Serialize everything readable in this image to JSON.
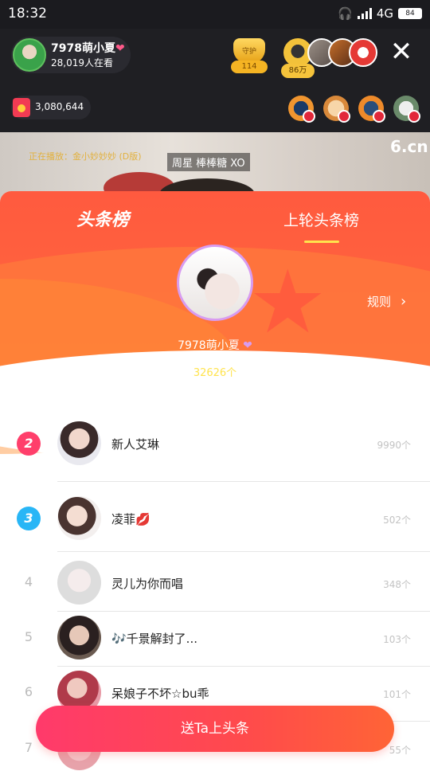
{
  "status_bar": {
    "time": "18:32",
    "network": "4G",
    "battery": "84"
  },
  "live": {
    "host_name": "7978萌小夏",
    "viewers": "28,019人在看",
    "guard_label": "守护",
    "guard_count": "114",
    "fan_badge": "86万",
    "coins": "3,080,644"
  },
  "video": {
    "scrolling_text": "正在播放：金小妙妙妙 (D版)",
    "song_label": "周星  棒棒糖  XO",
    "logo": "6.cn"
  },
  "sheet": {
    "tab_current": "头条榜",
    "tab_previous": "上轮头条榜",
    "top": {
      "name": "7978萌小夏",
      "count": "32626个"
    },
    "rules_label": "规则"
  },
  "ranking": [
    {
      "rank": "2",
      "name": "新人艾琳",
      "count": "9990个"
    },
    {
      "rank": "3",
      "name": "凌菲💋",
      "count": "502个"
    },
    {
      "rank": "4",
      "name": "灵儿为你而唱",
      "count": "348个"
    },
    {
      "rank": "5",
      "name": "🎶千景解封了...",
      "count": "103个"
    },
    {
      "rank": "6",
      "name": "呆娘子不坏☆bu乖",
      "count": "101个"
    },
    {
      "rank": "7",
      "name": "",
      "count": "55个"
    }
  ],
  "cta_label": "送Ta上头条",
  "colors": {
    "accent": "#ff5a3f",
    "highlight": "#ffe34d",
    "rank2": "#ff3f6b",
    "rank3": "#29b6f6"
  }
}
